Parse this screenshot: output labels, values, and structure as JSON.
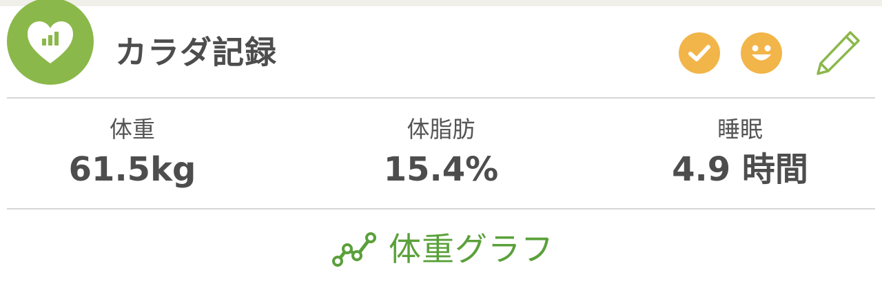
{
  "header": {
    "title": "カラダ記録",
    "logo_icon": "heart-chart-icon",
    "actions": [
      {
        "icon": "check-circle-icon"
      },
      {
        "icon": "smile-face-icon"
      },
      {
        "icon": "pencil-icon"
      }
    ]
  },
  "stats": {
    "weight": {
      "label": "体重",
      "value": "61.5kg"
    },
    "body_fat": {
      "label": "体脂肪",
      "value": "15.4%"
    },
    "sleep": {
      "label": "睡眠",
      "value": "4.9 時間"
    }
  },
  "graph_link": {
    "label": "体重グラフ",
    "icon": "line-graph-icon"
  },
  "colors": {
    "brand_green": "#8bb84a",
    "link_green": "#5aa03a",
    "action_yellow": "#f2b54a",
    "top_strip": "#f1efe9",
    "divider": "#d6d6d6"
  }
}
